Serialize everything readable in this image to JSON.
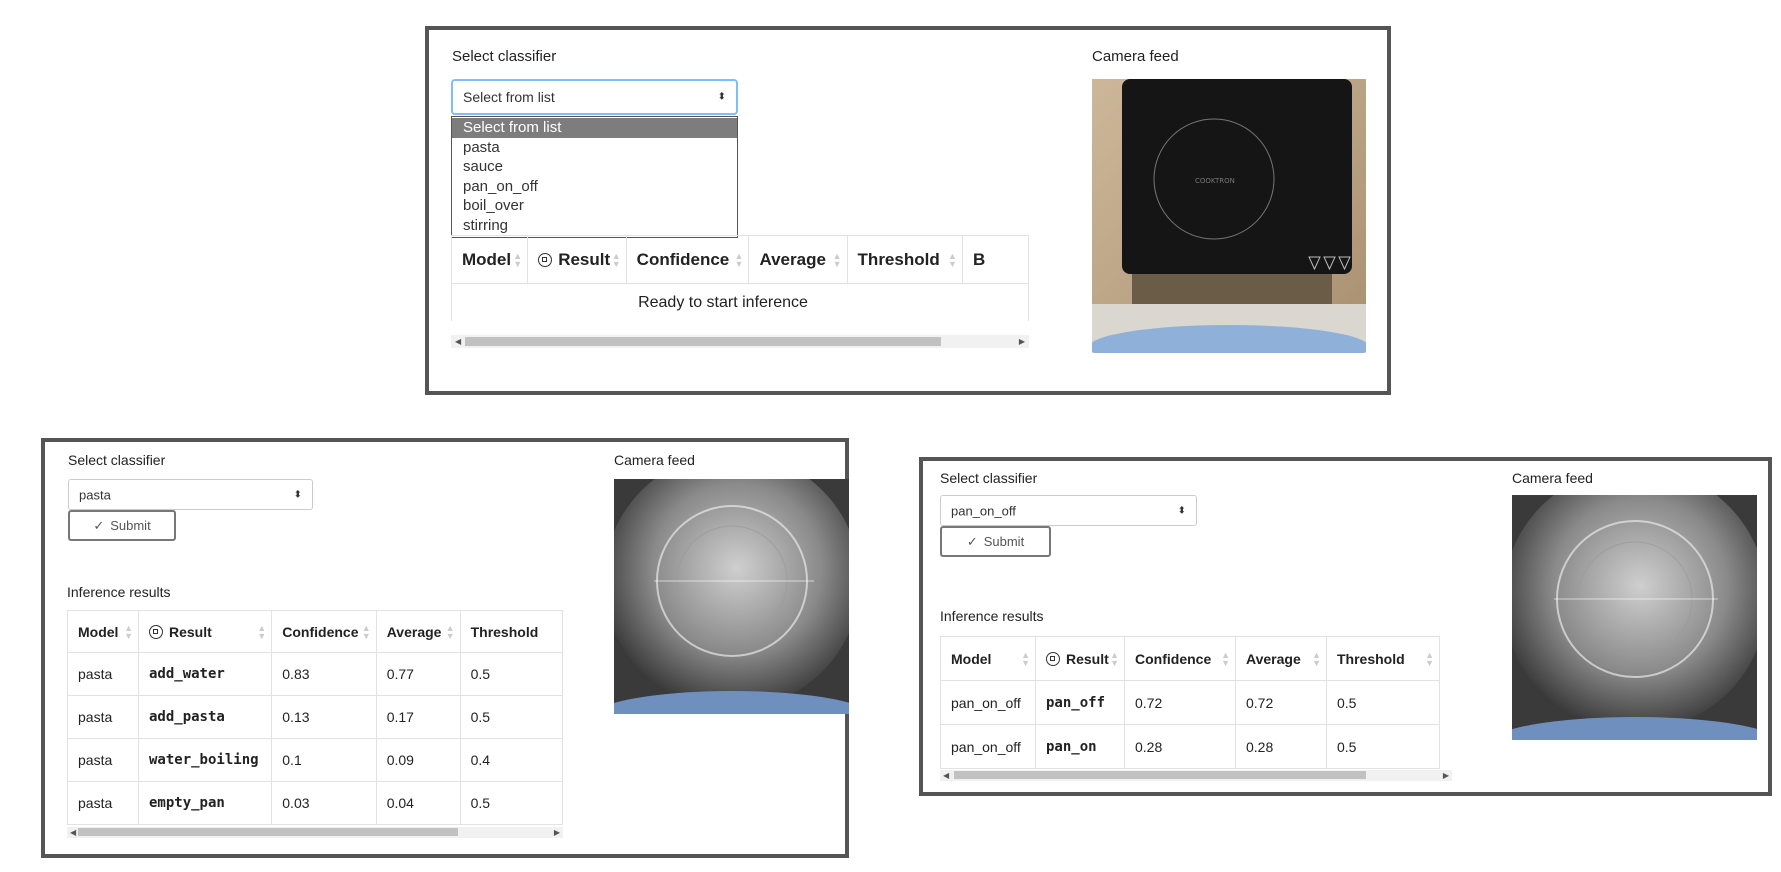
{
  "top_panel": {
    "select_label": "Select classifier",
    "select_value": "Select from list",
    "dropdown_options": [
      "Select from list",
      "pasta",
      "sauce",
      "pan_on_off",
      "boil_over",
      "stirring"
    ],
    "table_headers": [
      "Model",
      "Result",
      "Confidence",
      "Average",
      "Threshold",
      "B"
    ],
    "status_text": "Ready to start inference",
    "camera_label": "Camera feed"
  },
  "bottom_left_panel": {
    "select_label": "Select classifier",
    "select_value": "pasta",
    "submit_label": "Submit",
    "results_label": "Inference results",
    "table_headers": [
      "Model",
      "Result",
      "Confidence",
      "Average",
      "Threshold"
    ],
    "rows": [
      {
        "model": "pasta",
        "result": "add_water",
        "confidence": "0.83",
        "average": "0.77",
        "threshold": "0.5"
      },
      {
        "model": "pasta",
        "result": "add_pasta",
        "confidence": "0.13",
        "average": "0.17",
        "threshold": "0.5"
      },
      {
        "model": "pasta",
        "result": "water_boiling",
        "confidence": "0.1",
        "average": "0.09",
        "threshold": "0.4"
      },
      {
        "model": "pasta",
        "result": "empty_pan",
        "confidence": "0.03",
        "average": "0.04",
        "threshold": "0.5"
      }
    ],
    "camera_label": "Camera feed"
  },
  "bottom_right_panel": {
    "select_label": "Select classifier",
    "select_value": "pan_on_off",
    "submit_label": "Submit",
    "results_label": "Inference results",
    "table_headers": [
      "Model",
      "Result",
      "Confidence",
      "Average",
      "Threshold"
    ],
    "rows": [
      {
        "model": "pan_on_off",
        "result": "pan_off",
        "confidence": "0.72",
        "average": "0.72",
        "threshold": "0.5"
      },
      {
        "model": "pan_on_off",
        "result": "pan_on",
        "confidence": "0.28",
        "average": "0.28",
        "threshold": "0.5"
      }
    ],
    "camera_label": "Camera feed"
  },
  "icons": {
    "select_caret": "updown-caret-icon",
    "submit": "checkmark-icon",
    "result_header": "chip-icon",
    "sort": "sort-arrows-icon"
  },
  "colors": {
    "panel_border": "#555555",
    "dropdown_selected_bg": "#7d7d7d",
    "active_select_border": "#80bdff"
  }
}
